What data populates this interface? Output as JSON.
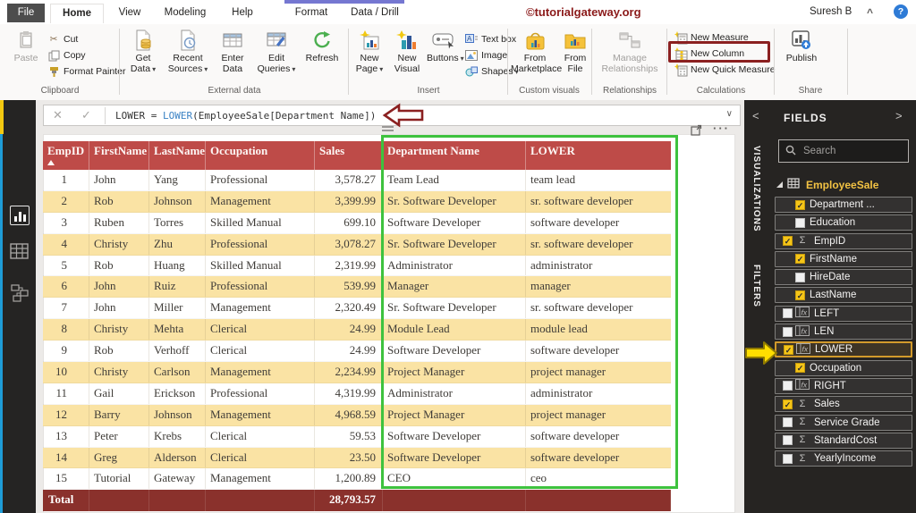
{
  "header": {
    "watermark": "©tutorialgateway.org",
    "user_name": "Suresh B"
  },
  "tabs": {
    "file": "File",
    "home": "Home",
    "view": "View",
    "modeling": "Modeling",
    "help": "Help",
    "format": "Format",
    "data_drill": "Data / Drill"
  },
  "ribbon": {
    "clipboard": {
      "group": "Clipboard",
      "paste": "Paste",
      "cut": "Cut",
      "copy": "Copy",
      "format_painter": "Format Painter"
    },
    "external_data": {
      "group": "External data",
      "get_data": "Get Data",
      "recent_sources": "Recent Sources",
      "enter_data": "Enter Data",
      "edit_queries": "Edit Queries",
      "refresh": "Refresh"
    },
    "insert": {
      "group": "Insert",
      "new_page": "New Page",
      "new_visual": "New Visual",
      "buttons": "Buttons",
      "text_box": "Text box",
      "image": "Image",
      "shapes": "Shapes"
    },
    "custom_visuals": {
      "group": "Custom visuals",
      "from_marketplace": "From Marketplace",
      "from_file": "From File"
    },
    "relationships": {
      "group": "Relationships",
      "manage_relationships": "Manage Relationships"
    },
    "calculations": {
      "group": "Calculations",
      "new_measure": "New Measure",
      "new_column": "New Column",
      "new_quick_measure": "New Quick Measure"
    },
    "share": {
      "group": "Share",
      "publish": "Publish"
    }
  },
  "formula_bar": {
    "lhs": "LOWER = ",
    "fn": "LOWER",
    "rest": "(EmployeeSale[Department Name])"
  },
  "table": {
    "columns": [
      "EmpID",
      "FirstName",
      "LastName",
      "Occupation",
      "Sales",
      "Department Name",
      "LOWER"
    ],
    "rows": [
      [
        "1",
        "John",
        "Yang",
        "Professional",
        "3,578.27",
        "Team Lead",
        "team lead"
      ],
      [
        "2",
        "Rob",
        "Johnson",
        "Management",
        "3,399.99",
        "Sr. Software Developer",
        "sr. software developer"
      ],
      [
        "3",
        "Ruben",
        "Torres",
        "Skilled Manual",
        "699.10",
        "Software Developer",
        "software developer"
      ],
      [
        "4",
        "Christy",
        "Zhu",
        "Professional",
        "3,078.27",
        "Sr. Software Developer",
        "sr. software developer"
      ],
      [
        "5",
        "Rob",
        "Huang",
        "Skilled Manual",
        "2,319.99",
        "Administrator",
        "administrator"
      ],
      [
        "6",
        "John",
        "Ruiz",
        "Professional",
        "539.99",
        "Manager",
        "manager"
      ],
      [
        "7",
        "John",
        "Miller",
        "Management",
        "2,320.49",
        "Sr. Software Developer",
        "sr. software developer"
      ],
      [
        "8",
        "Christy",
        "Mehta",
        "Clerical",
        "24.99",
        "Module Lead",
        "module lead"
      ],
      [
        "9",
        "Rob",
        "Verhoff",
        "Clerical",
        "24.99",
        "Software Developer",
        "software developer"
      ],
      [
        "10",
        "Christy",
        "Carlson",
        "Management",
        "2,234.99",
        "Project Manager",
        "project manager"
      ],
      [
        "11",
        "Gail",
        "Erickson",
        "Professional",
        "4,319.99",
        "Administrator",
        "administrator"
      ],
      [
        "12",
        "Barry",
        "Johnson",
        "Management",
        "4,968.59",
        "Project Manager",
        "project manager"
      ],
      [
        "13",
        "Peter",
        "Krebs",
        "Clerical",
        "59.53",
        "Software Developer",
        "software developer"
      ],
      [
        "14",
        "Greg",
        "Alderson",
        "Clerical",
        "23.50",
        "Software Developer",
        "software developer"
      ],
      [
        "15",
        "Tutorial",
        "Gateway",
        "Management",
        "1,200.89",
        "CEO",
        "ceo"
      ]
    ],
    "total_label": "Total",
    "total_sales": "28,793.57"
  },
  "side_strips": {
    "visualizations_label": "VISUALIZATIONS",
    "filters_label": "FILTERS"
  },
  "fields_panel": {
    "title": "FIELDS",
    "search_placeholder": "Search",
    "table_name": "EmployeeSale",
    "fields": [
      {
        "name": "Department ...",
        "checked": true,
        "icon": "none"
      },
      {
        "name": "Education",
        "checked": false,
        "icon": "none"
      },
      {
        "name": "EmpID",
        "checked": true,
        "icon": "sigma"
      },
      {
        "name": "FirstName",
        "checked": true,
        "icon": "none"
      },
      {
        "name": "HireDate",
        "checked": false,
        "icon": "none"
      },
      {
        "name": "LastName",
        "checked": true,
        "icon": "none"
      },
      {
        "name": "LEFT",
        "checked": false,
        "icon": "fx"
      },
      {
        "name": "LEN",
        "checked": false,
        "icon": "fx"
      },
      {
        "name": "LOWER",
        "checked": true,
        "icon": "fx",
        "highlighted": true
      },
      {
        "name": "Occupation",
        "checked": true,
        "icon": "none"
      },
      {
        "name": "RIGHT",
        "checked": false,
        "icon": "fx"
      },
      {
        "name": "Sales",
        "checked": true,
        "icon": "sigma"
      },
      {
        "name": "Service Grade",
        "checked": false,
        "icon": "sigma"
      },
      {
        "name": "StandardCost",
        "checked": false,
        "icon": "sigma"
      },
      {
        "name": "YearlyIncome",
        "checked": false,
        "icon": "sigma"
      }
    ]
  },
  "colors": {
    "table_header_red": "#BE4B48",
    "table_total_maroon": "#8A312C",
    "row_stripe_yellow": "#FAE3A4",
    "annotation_green": "#3EC23E",
    "annotation_dark_red": "#8B2020",
    "annotation_yellow_arrow": "#FFDE00",
    "accent_yellow": "#F2C811",
    "panel_dark": "#262422"
  }
}
